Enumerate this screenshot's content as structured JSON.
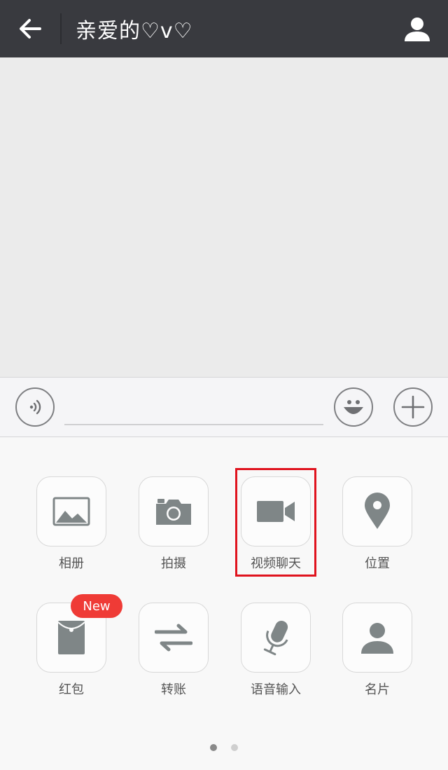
{
  "header": {
    "title": "亲爱的♡v♡"
  },
  "input": {
    "value": "",
    "placeholder": ""
  },
  "panel": {
    "page1": [
      {
        "label": "相册",
        "icon": "image-icon"
      },
      {
        "label": "拍摄",
        "icon": "camera-icon"
      },
      {
        "label": "视频聊天",
        "icon": "video-camera-icon"
      },
      {
        "label": "位置",
        "icon": "location-pin-icon"
      },
      {
        "label": "红包",
        "icon": "red-envelope-icon"
      },
      {
        "label": "转账",
        "icon": "transfer-arrows-icon"
      },
      {
        "label": "语音输入",
        "icon": "microphone-icon"
      },
      {
        "label": "名片",
        "icon": "person-icon"
      }
    ],
    "badge": "New",
    "page_indicator": {
      "current": 1,
      "total": 2
    }
  },
  "colors": {
    "topbar": "#393a3f",
    "highlight": "#e0131e",
    "badge": "#ef3b36",
    "icon": "#7f8687"
  }
}
